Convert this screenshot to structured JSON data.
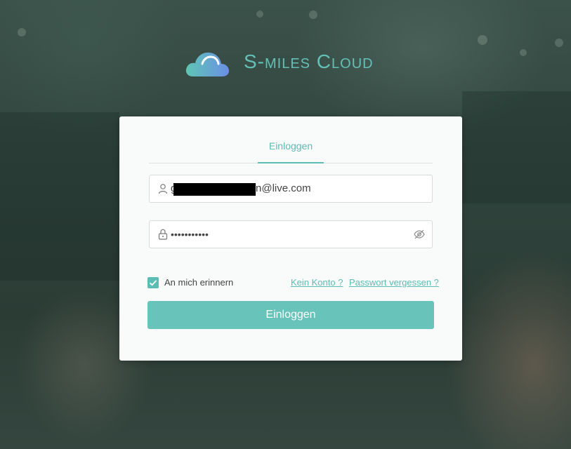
{
  "brand": {
    "name": "S-miles Cloud",
    "logo_icon": "cloud-icon",
    "accent_color": "#5bbdb3"
  },
  "login": {
    "tab_label": "Einloggen",
    "email": {
      "icon": "user-icon",
      "value_prefix": "g",
      "value_suffix": "n@live.com",
      "redacted": true
    },
    "password": {
      "icon": "lock-icon",
      "value": "•••••••••••",
      "toggle_icon": "eye-off-icon"
    },
    "remember": {
      "label": "An mich erinnern",
      "checked": true
    },
    "links": {
      "register": "Kein Konto ?",
      "forgot": "Passwort vergessen ?"
    },
    "submit_label": "Einloggen"
  }
}
